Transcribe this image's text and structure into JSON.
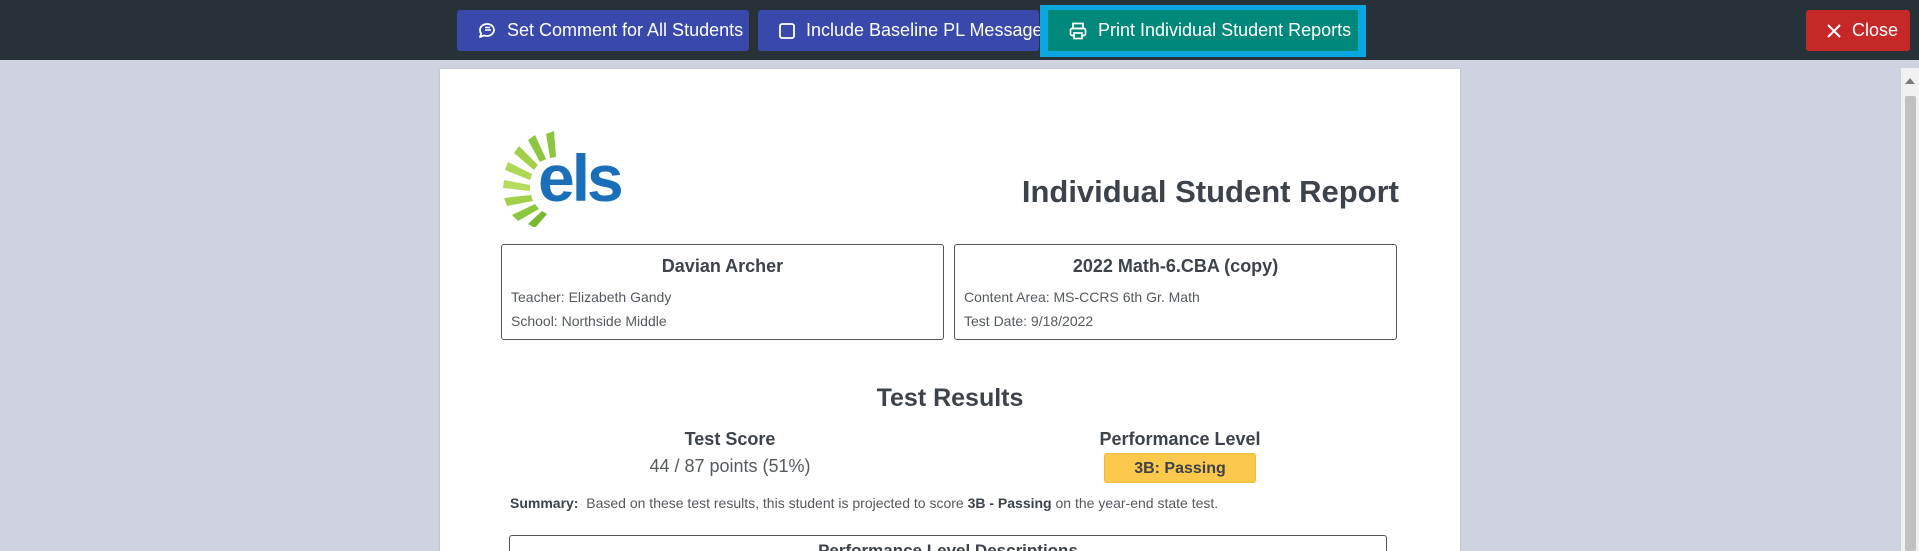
{
  "toolbar": {
    "comment_label": "Set Comment for All Students",
    "baseline_label": "Include Baseline PL Message",
    "print_label": "Print Individual Student Reports",
    "close_label": "Close"
  },
  "report": {
    "logo_text": "els",
    "title": "Individual Student Report",
    "student": {
      "name": "Davian Archer",
      "teacher": "Teacher: Elizabeth Gandy",
      "school": "School: Northside Middle"
    },
    "test": {
      "name": "2022 Math-6.CBA (copy)",
      "content_area": "Content Area: MS-CCRS 6th Gr. Math",
      "test_date": "Test Date: 9/18/2022"
    },
    "results": {
      "heading": "Test Results",
      "score_label": "Test Score",
      "score_value": "44 / 87 points (51%)",
      "level_label": "Performance Level",
      "level_value": "3B: Passing"
    },
    "summary": {
      "label": "Summary:",
      "prefix": "Based on these test results, this student is projected to score",
      "level": "3B - Passing",
      "suffix": "on the year-end state test."
    },
    "pld_heading": "Performance Level Descriptions"
  },
  "colors": {
    "topbar": "#263238",
    "primary": "#3949ab",
    "print": "#00897b",
    "print_focus": "#0aa6e0",
    "close": "#c62828",
    "badge": "#fdc94d",
    "logo_blue": "#1a6fb8",
    "logo_green": "#8cc63f"
  }
}
